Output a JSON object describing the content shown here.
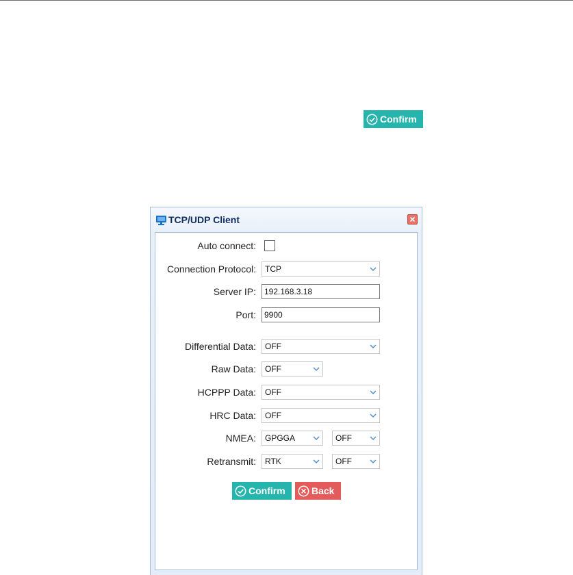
{
  "top_confirm_label": "Confirm",
  "dialog": {
    "title": "TCP/UDP Client",
    "icon": "monitor-icon",
    "fields": {
      "auto_connect": {
        "label": "Auto connect:",
        "checked": false
      },
      "protocol": {
        "label": "Connection Protocol:",
        "value": "TCP"
      },
      "server_ip": {
        "label": "Server IP:",
        "value": "192.168.3.18"
      },
      "port": {
        "label": "Port:",
        "value": "9900"
      },
      "differential": {
        "label": "Differential Data:",
        "value": "OFF"
      },
      "raw": {
        "label": "Raw Data:",
        "value": "OFF"
      },
      "hcppp": {
        "label": "HCPPP Data:",
        "value": "OFF"
      },
      "hrc": {
        "label": "HRC Data:",
        "value": "OFF"
      },
      "nmea": {
        "label": "NMEA:",
        "type": "GPGGA",
        "rate": "OFF"
      },
      "retransmit": {
        "label": "Retransmit:",
        "type": "RTK",
        "rate": "OFF"
      }
    },
    "buttons": {
      "confirm": "Confirm",
      "back": "Back"
    }
  },
  "colors": {
    "confirm": "#26b5ad",
    "back": "#e35b5b",
    "title": "#0e2d5f",
    "border": "#9fbcda"
  }
}
